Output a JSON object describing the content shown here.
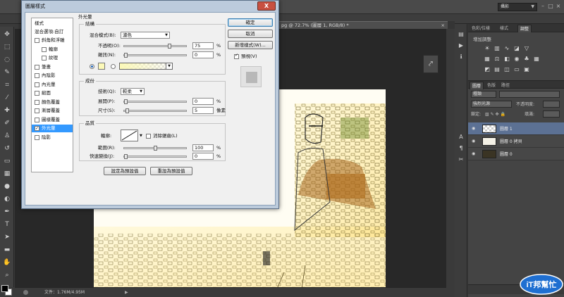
{
  "app": {
    "workspace": "攝影",
    "document_tab": "pg @ 72.7% (圖層 1, RGB/8) *",
    "status_file": "文件：1.76M/4.95M"
  },
  "colors": {
    "ps_bg": "#3a3a3a",
    "canvas": "#fffef6",
    "selected_layer": "#5c7194",
    "dialog_frame": "#bccbdc",
    "list_select": "#3399ff",
    "glow_color": "#fcf9b8"
  },
  "icons": {
    "toolbar": [
      "move-icon",
      "marquee-icon",
      "lasso-icon",
      "quick-select-icon",
      "crop-icon",
      "eyedropper-icon",
      "healing-brush-icon",
      "brush-icon",
      "clone-stamp-icon",
      "history-brush-icon",
      "eraser-icon",
      "gradient-icon",
      "blur-icon",
      "dodge-icon",
      "pen-icon",
      "type-icon",
      "path-select-icon",
      "shape-icon",
      "hand-icon",
      "zoom-icon"
    ],
    "dock": [
      "history-icon",
      "properties-icon",
      "character-icon",
      "paragraph-icon",
      "info-icon"
    ]
  },
  "right_panel": {
    "tabs": [
      "色彩/位樣",
      "樣式",
      "調整"
    ],
    "adjust_title": "增加調整",
    "layer_tabs": [
      "圖層",
      "色版",
      "路徑"
    ],
    "kind_label": "種類",
    "blend_mode": "強烈光源",
    "opacity_label": "不透明度:",
    "lock_label": "鎖定:",
    "fill_label": "填滿:",
    "layers": [
      {
        "name": "圖層 1",
        "selected": true
      },
      {
        "name": "圖層 0 拷貝",
        "selected": false
      },
      {
        "name": "圖層 0",
        "selected": false
      }
    ]
  },
  "logo": {
    "text": "iT邦幫忙"
  },
  "dialog": {
    "title": "圖層樣式",
    "close": "X",
    "ok": "確定",
    "cancel": "取消",
    "new_style": "新增樣式(W)...",
    "preview_label": "預視(V)",
    "preview_on": true,
    "styles_header": "樣式",
    "blend_options": "混合選項:自訂",
    "style_items": [
      {
        "label": "斜角和浮雕",
        "checked": false,
        "indent": false,
        "selected": false
      },
      {
        "label": "輪廓",
        "checked": false,
        "indent": true,
        "selected": false
      },
      {
        "label": "紋理",
        "checked": false,
        "indent": true,
        "selected": false
      },
      {
        "label": "筆畫",
        "checked": false,
        "indent": false,
        "selected": false
      },
      {
        "label": "內陰影",
        "checked": false,
        "indent": false,
        "selected": false
      },
      {
        "label": "內光暈",
        "checked": false,
        "indent": false,
        "selected": false
      },
      {
        "label": "緞面",
        "checked": false,
        "indent": false,
        "selected": false
      },
      {
        "label": "顏色覆蓋",
        "checked": false,
        "indent": false,
        "selected": false
      },
      {
        "label": "漸層覆蓋",
        "checked": false,
        "indent": false,
        "selected": false
      },
      {
        "label": "圖樣覆蓋",
        "checked": false,
        "indent": false,
        "selected": false
      },
      {
        "label": "外光暈",
        "checked": true,
        "indent": false,
        "selected": true
      },
      {
        "label": "陰影",
        "checked": false,
        "indent": false,
        "selected": false
      }
    ],
    "panel_title": "外光暈",
    "structure": {
      "group": "結構",
      "blend_label": "混合模式(B):",
      "blend_value": "濾色",
      "opacity_label": "不透明(O):",
      "opacity_value": "75",
      "opacity_frac": 0.75,
      "noise_label": "雜訊(N):",
      "noise_value": "0",
      "noise_frac": 0.0,
      "percent": "%"
    },
    "elements": {
      "group": "成份",
      "technique_label": "技術(Q):",
      "technique_value": "較柔",
      "spread_label": "展開(P):",
      "spread_value": "0",
      "spread_frac": 0.0,
      "size_label": "尺寸(S):",
      "size_value": "5",
      "size_frac": 0.02,
      "percent": "%",
      "px_unit": "像素"
    },
    "quality": {
      "group": "品質",
      "contour_label": "輪廓:",
      "antialias_label": "消除鋸齒(L)",
      "range_label": "範圍(R):",
      "range_value": "100",
      "range_frac": 0.5,
      "jitter_label": "快速變換(J):",
      "jitter_value": "0",
      "jitter_frac": 0.0,
      "percent": "%"
    },
    "make_default": "設定為預設值",
    "reset_default": "重設為預設值"
  }
}
